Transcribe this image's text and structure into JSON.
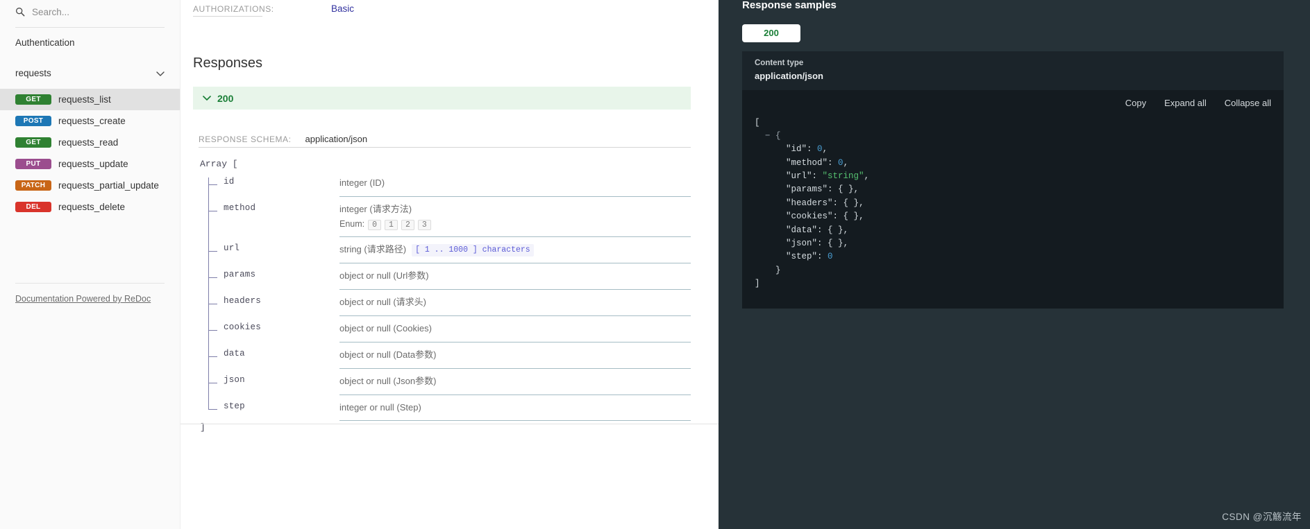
{
  "sidebar": {
    "search": {
      "placeholder": "Search...",
      "value": "",
      "icon": "search-icon"
    },
    "nav_items": [
      {
        "label": "Authentication",
        "type": "section"
      },
      {
        "label": "requests",
        "type": "group",
        "icon": "chevron-down-icon",
        "expanded": true
      }
    ],
    "operations": [
      {
        "verb": "GET",
        "verb_class": "get",
        "label": "requests_list",
        "active": true
      },
      {
        "verb": "POST",
        "verb_class": "post",
        "label": "requests_create",
        "active": false
      },
      {
        "verb": "GET",
        "verb_class": "get",
        "label": "requests_read",
        "active": false
      },
      {
        "verb": "PUT",
        "verb_class": "put",
        "label": "requests_update",
        "active": false
      },
      {
        "verb": "PATCH",
        "verb_class": "patch",
        "label": "requests_partial_update",
        "active": false
      },
      {
        "verb": "DEL",
        "verb_class": "del",
        "label": "requests_delete",
        "active": false
      }
    ],
    "footer_link": "Documentation Powered by ReDoc"
  },
  "main": {
    "authorizations_label": "AUTHORIZATIONS:",
    "authorizations_value": "Basic",
    "responses_title": "Responses",
    "response_banner": {
      "code": "200",
      "icon": "chevron-down-icon"
    },
    "schema_label": "RESPONSE SCHEMA:",
    "schema_content_type": "application/json",
    "array_open": "Array [",
    "array_close": "]",
    "fields": [
      {
        "name": "id",
        "type": "integer (ID)"
      },
      {
        "name": "method",
        "type": "integer (请求方法)",
        "enum_label": "Enum:",
        "enum": [
          "0",
          "1",
          "2",
          "3"
        ]
      },
      {
        "name": "url",
        "type": "string (请求路径)",
        "constraint": "[ 1 .. 1000 ] characters"
      },
      {
        "name": "params",
        "type": "object or null (Url参数)"
      },
      {
        "name": "headers",
        "type": "object or null (请求头)"
      },
      {
        "name": "cookies",
        "type": "object or null (Cookies)"
      },
      {
        "name": "data",
        "type": "object or null (Data参数)"
      },
      {
        "name": "json",
        "type": "object or null (Json参数)"
      },
      {
        "name": "step",
        "type": "integer or null (Step)"
      }
    ]
  },
  "right_panel": {
    "title": "Response samples",
    "tab": "200",
    "content_type_label": "Content type",
    "content_type_value": "application/json",
    "actions": {
      "copy": "Copy",
      "expand_all": "Expand all",
      "collapse_all": "Collapse all"
    },
    "sample_lines": [
      {
        "indent": 0,
        "text": "["
      },
      {
        "indent": 1,
        "text": "− {",
        "collapser": true
      },
      {
        "indent": 3,
        "key": "\"id\"",
        "sep": ": ",
        "value": "0",
        "value_type": "num",
        "trail": ","
      },
      {
        "indent": 3,
        "key": "\"method\"",
        "sep": ": ",
        "value": "0",
        "value_type": "num",
        "trail": ","
      },
      {
        "indent": 3,
        "key": "\"url\"",
        "sep": ": ",
        "value": "\"string\"",
        "value_type": "str",
        "trail": ","
      },
      {
        "indent": 3,
        "key": "\"params\"",
        "sep": ": ",
        "value": "{ }",
        "value_type": "punct",
        "trail": ","
      },
      {
        "indent": 3,
        "key": "\"headers\"",
        "sep": ": ",
        "value": "{ }",
        "value_type": "punct",
        "trail": ","
      },
      {
        "indent": 3,
        "key": "\"cookies\"",
        "sep": ": ",
        "value": "{ }",
        "value_type": "punct",
        "trail": ","
      },
      {
        "indent": 3,
        "key": "\"data\"",
        "sep": ": ",
        "value": "{ }",
        "value_type": "punct",
        "trail": ","
      },
      {
        "indent": 3,
        "key": "\"json\"",
        "sep": ": ",
        "value": "{ }",
        "value_type": "punct",
        "trail": ","
      },
      {
        "indent": 3,
        "key": "\"step\"",
        "sep": ": ",
        "value": "0",
        "value_type": "num",
        "trail": ""
      },
      {
        "indent": 2,
        "text": "}"
      },
      {
        "indent": 0,
        "text": "]"
      }
    ]
  },
  "watermark": "CSDN @沉觞流年",
  "colors": {
    "get": "#2f8132",
    "post": "#1d77b5",
    "put": "#9b4d8e",
    "patch": "#c86516",
    "del": "#d9342b",
    "success": "#1a7f37",
    "link": "#32329f",
    "panel_bg": "#263238",
    "code_bg": "#141b20"
  }
}
